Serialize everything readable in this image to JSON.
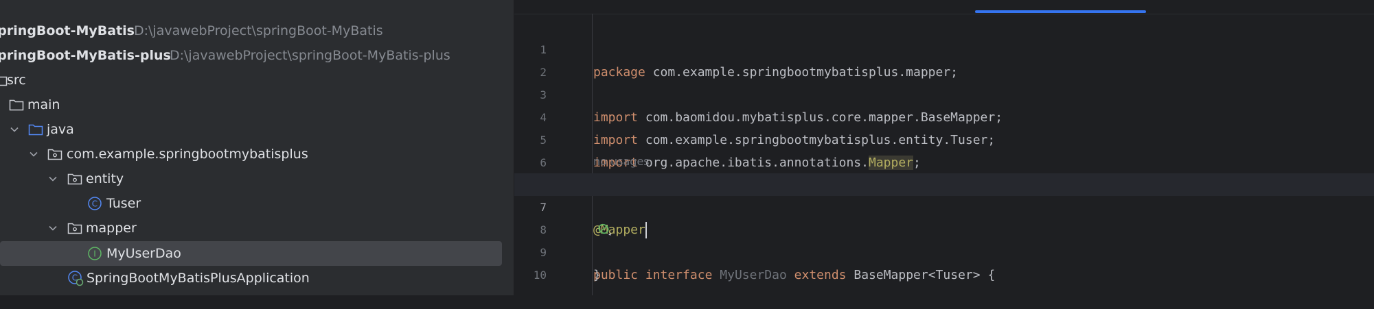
{
  "project_tree": [
    {
      "name": "springBoot-MyBatis",
      "path": "D:\\javawebProject\\springBoot-MyBatis"
    },
    {
      "name": "springBoot-MyBatis-plus",
      "path": "D:\\javawebProject\\springBoot-MyBatis-plus"
    },
    {
      "name": "src"
    },
    {
      "name": "main"
    },
    {
      "name": "java"
    },
    {
      "name": "com.example.springbootmybatisplus"
    },
    {
      "name": "entity"
    },
    {
      "name": "Tuser",
      "icon": "class-icon"
    },
    {
      "name": "mapper"
    },
    {
      "name": "MyUserDao",
      "icon": "interface-icon",
      "selected": true
    },
    {
      "name": "SpringBootMyBatisPlusApplication",
      "icon": "spring-class-icon"
    }
  ],
  "editor": {
    "line_numbers": [
      "1",
      "2",
      "3",
      "4",
      "5",
      "6",
      "7",
      "8",
      "9",
      "10"
    ],
    "current_line": "7",
    "code": {
      "l1_kw": "package",
      "l1_rest": " com.example.springbootmybatisplus.mapper;",
      "l3_kw": "import",
      "l3_rest": " com.baomidou.mybatisplus.core.mapper.BaseMapper;",
      "l4_kw": "import",
      "l4_rest": " com.example.springbootmybatisplus.entity.Tuser;",
      "l5_kw": "import",
      "l5_rest": " org.apache.ibatis.annotations.",
      "l5_hl": "Mapper",
      "l5_end": ";",
      "l7": "@Mapper",
      "l8_kw1": "public",
      "l8_kw2": "interface",
      "l8_name": "MyUserDao",
      "l8_kw3": "extends",
      "l8_rest": " BaseMapper<Tuser> {",
      "l9": "}"
    },
    "inlay_hint": "no usages"
  },
  "colors": {
    "accent": "#3574f0",
    "keyword": "#cf8e6d",
    "annotation": "#b3ae60",
    "text": "#bcbec4"
  }
}
